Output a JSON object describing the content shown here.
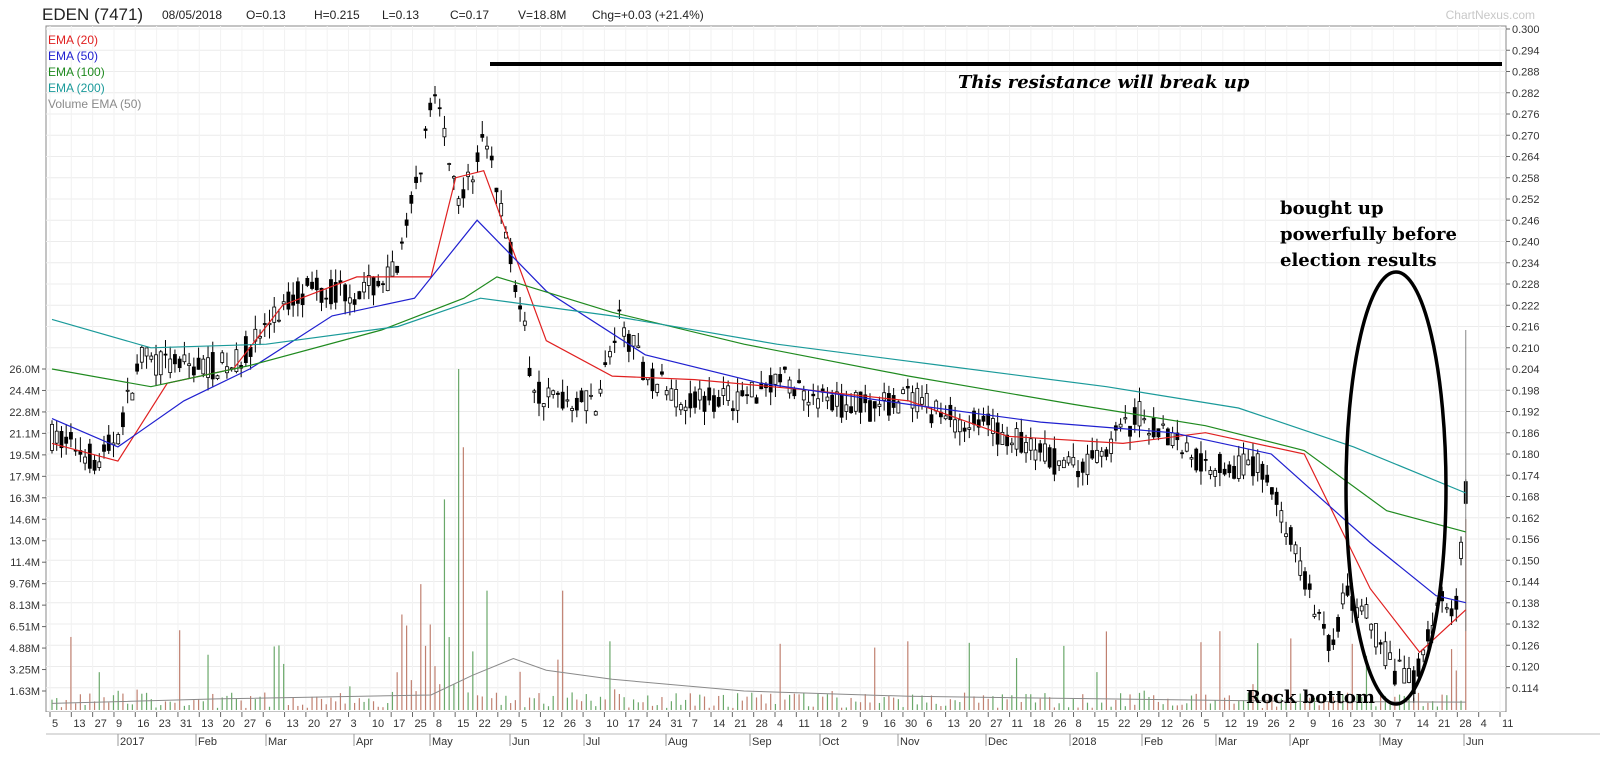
{
  "header": {
    "symbol": "EDEN (7471)",
    "date": "08/05/2018",
    "open": "O=0.13",
    "high": "H=0.215",
    "low": "L=0.13",
    "close": "C=0.17",
    "volume": "V=18.8M",
    "change": "Chg=+0.03 (+21.4%)",
    "watermark": "ChartNexus.com"
  },
  "chart_data": {
    "type": "line",
    "legend": [
      {
        "name": "EMA (20)",
        "color": "#e02020"
      },
      {
        "name": "EMA (50)",
        "color": "#2020d0"
      },
      {
        "name": "EMA (100)",
        "color": "#1f8a1f"
      },
      {
        "name": "EMA (200)",
        "color": "#1a9a9a"
      },
      {
        "name": "Volume EMA (50)",
        "color": "#8a8a8a"
      }
    ],
    "price_axis": {
      "ylim": [
        0.108,
        0.3
      ],
      "ticks": [
        "0.300",
        "0.294",
        "0.288",
        "0.282",
        "0.276",
        "0.270",
        "0.264",
        "0.258",
        "0.252",
        "0.246",
        "0.240",
        "0.234",
        "0.228",
        "0.222",
        "0.216",
        "0.210",
        "0.204",
        "0.198",
        "0.192",
        "0.186",
        "0.180",
        "0.174",
        "0.168",
        "0.162",
        "0.156",
        "0.150",
        "0.144",
        "0.138",
        "0.132",
        "0.126",
        "0.120",
        "0.114"
      ]
    },
    "volume_axis": {
      "ticks": [
        "26.0M",
        "24.4M",
        "22.8M",
        "21.1M",
        "19.5M",
        "17.9M",
        "16.3M",
        "14.6M",
        "13.0M",
        "11.4M",
        "9.76M",
        "8.13M",
        "6.51M",
        "4.88M",
        "3.25M",
        "1.63M"
      ]
    },
    "x_axis": {
      "date_ticks": [
        "5",
        "13",
        "27",
        "9",
        "16",
        "23",
        "31",
        "13",
        "20",
        "27",
        "6",
        "13",
        "20",
        "27",
        "3",
        "10",
        "17",
        "25",
        "8",
        "15",
        "22",
        "29",
        "5",
        "12",
        "26",
        "3",
        "10",
        "17",
        "24",
        "31",
        "7",
        "14",
        "21",
        "28",
        "4",
        "11",
        "18",
        "2",
        "9",
        "16",
        "30",
        "6",
        "13",
        "20",
        "27",
        "11",
        "18",
        "26",
        "8",
        "15",
        "22",
        "29",
        "12",
        "26",
        "5",
        "12",
        "19",
        "26",
        "2",
        "9",
        "16",
        "23",
        "30",
        "7",
        "14",
        "21",
        "28",
        "4",
        "11"
      ],
      "month_labels": [
        "2017",
        "Feb",
        "Mar",
        "Apr",
        "May",
        "Jun",
        "Jul",
        "Aug",
        "Sep",
        "Oct",
        "Nov",
        "Dec",
        "2018",
        "Feb",
        "Mar",
        "Apr",
        "May",
        "Jun"
      ]
    },
    "price_key_points": [
      {
        "x": "2017-01-05",
        "y": 0.185
      },
      {
        "x": "2017-01-25",
        "y": 0.177
      },
      {
        "x": "2017-02-10",
        "y": 0.207
      },
      {
        "x": "2017-03-10",
        "y": 0.204
      },
      {
        "x": "2017-04-15",
        "y": 0.229
      },
      {
        "x": "2017-05-15",
        "y": 0.232
      },
      {
        "x": "2017-05-24",
        "y": 0.284
      },
      {
        "x": "2017-06-05",
        "y": 0.288
      },
      {
        "x": "2017-06-15",
        "y": 0.196
      },
      {
        "x": "2017-07-24",
        "y": 0.218
      },
      {
        "x": "2017-09-11",
        "y": 0.199
      },
      {
        "x": "2017-11-06",
        "y": 0.198
      },
      {
        "x": "2017-12-27",
        "y": 0.171
      },
      {
        "x": "2018-01-15",
        "y": 0.192
      },
      {
        "x": "2018-02-20",
        "y": 0.176
      },
      {
        "x": "2018-03-12",
        "y": 0.122
      },
      {
        "x": "2018-04-05",
        "y": 0.115
      },
      {
        "x": "2018-04-30",
        "y": 0.14
      },
      {
        "x": "2018-05-08",
        "y": 0.17
      }
    ],
    "ema": {
      "ema20": [
        [
          0,
          0.183
        ],
        [
          40,
          0.178
        ],
        [
          70,
          0.2
        ],
        [
          110,
          0.204
        ],
        [
          140,
          0.222
        ],
        [
          185,
          0.23
        ],
        [
          230,
          0.23
        ],
        [
          245,
          0.258
        ],
        [
          262,
          0.26
        ],
        [
          300,
          0.212
        ],
        [
          340,
          0.202
        ],
        [
          390,
          0.201
        ],
        [
          460,
          0.198
        ],
        [
          520,
          0.195
        ],
        [
          580,
          0.185
        ],
        [
          650,
          0.183
        ],
        [
          700,
          0.186
        ],
        [
          760,
          0.18
        ],
        [
          800,
          0.142
        ],
        [
          830,
          0.124
        ],
        [
          858,
          0.136
        ]
      ],
      "ema50": [
        [
          0,
          0.19
        ],
        [
          40,
          0.182
        ],
        [
          80,
          0.195
        ],
        [
          120,
          0.204
        ],
        [
          170,
          0.219
        ],
        [
          220,
          0.224
        ],
        [
          258,
          0.246
        ],
        [
          300,
          0.226
        ],
        [
          360,
          0.208
        ],
        [
          430,
          0.2
        ],
        [
          520,
          0.194
        ],
        [
          600,
          0.189
        ],
        [
          680,
          0.186
        ],
        [
          740,
          0.18
        ],
        [
          800,
          0.155
        ],
        [
          840,
          0.14
        ],
        [
          858,
          0.138
        ]
      ],
      "ema100": [
        [
          0,
          0.204
        ],
        [
          60,
          0.199
        ],
        [
          120,
          0.205
        ],
        [
          200,
          0.215
        ],
        [
          250,
          0.224
        ],
        [
          270,
          0.23
        ],
        [
          340,
          0.22
        ],
        [
          420,
          0.211
        ],
        [
          520,
          0.202
        ],
        [
          620,
          0.194
        ],
        [
          700,
          0.188
        ],
        [
          760,
          0.181
        ],
        [
          810,
          0.164
        ],
        [
          858,
          0.158
        ]
      ],
      "ema200": [
        [
          0,
          0.218
        ],
        [
          60,
          0.21
        ],
        [
          130,
          0.211
        ],
        [
          210,
          0.216
        ],
        [
          260,
          0.224
        ],
        [
          340,
          0.219
        ],
        [
          440,
          0.211
        ],
        [
          540,
          0.205
        ],
        [
          640,
          0.199
        ],
        [
          720,
          0.193
        ],
        [
          790,
          0.182
        ],
        [
          858,
          0.169
        ]
      ],
      "vol_ema": [
        [
          0,
          0.35
        ],
        [
          100,
          0.7
        ],
        [
          230,
          1.0
        ],
        [
          255,
          2.5
        ],
        [
          280,
          3.8
        ],
        [
          300,
          2.9
        ],
        [
          340,
          2.2
        ],
        [
          420,
          1.3
        ],
        [
          520,
          0.9
        ],
        [
          640,
          0.7
        ],
        [
          760,
          0.5
        ],
        [
          858,
          0.45
        ]
      ]
    },
    "annotations": {
      "resistance": "This resistance will break up",
      "election": [
        "bought up",
        "powerfully before",
        "election results"
      ],
      "bottom": "Rock bottom"
    }
  }
}
